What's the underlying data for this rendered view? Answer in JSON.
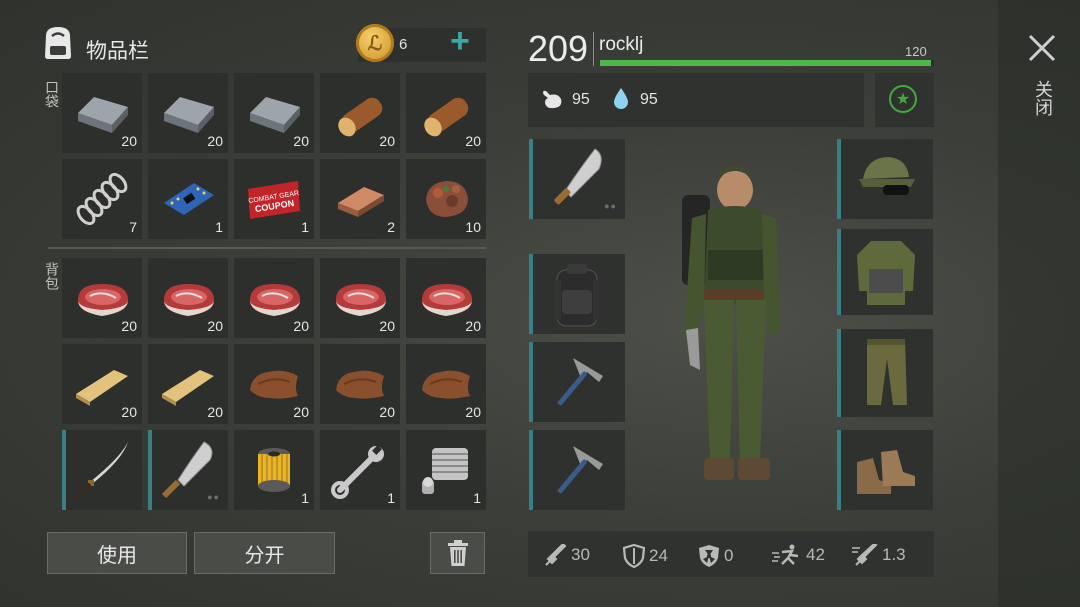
{
  "inventory": {
    "title": "物品栏",
    "coins": "6",
    "add_label": "+",
    "pocket_label": "口袋",
    "backpack_label": "背包",
    "pocket_items": [
      {
        "icon": "iron-bar-icon",
        "count": "20"
      },
      {
        "icon": "iron-bar-icon",
        "count": "20"
      },
      {
        "icon": "iron-bar-icon",
        "count": "20"
      },
      {
        "icon": "log-icon",
        "count": "20"
      },
      {
        "icon": "log-icon",
        "count": "20"
      },
      {
        "icon": "spring-icon",
        "count": "7"
      },
      {
        "icon": "circuit-board-icon",
        "count": "1"
      },
      {
        "icon": "coupon-icon",
        "count": "1",
        "text": "COMBAT GEAR COUPON"
      },
      {
        "icon": "copper-bar-icon",
        "count": "2"
      },
      {
        "icon": "ore-icon",
        "count": "10"
      }
    ],
    "backpack_items": [
      {
        "icon": "raw-meat-icon",
        "count": "20"
      },
      {
        "icon": "raw-meat-icon",
        "count": "20"
      },
      {
        "icon": "raw-meat-icon",
        "count": "20"
      },
      {
        "icon": "raw-meat-icon",
        "count": "20"
      },
      {
        "icon": "raw-meat-icon",
        "count": "20"
      },
      {
        "icon": "wood-plank-icon",
        "count": "20"
      },
      {
        "icon": "wood-plank-icon",
        "count": "20"
      },
      {
        "icon": "leather-icon",
        "count": "20"
      },
      {
        "icon": "leather-icon",
        "count": "20"
      },
      {
        "icon": "leather-icon",
        "count": "20"
      },
      {
        "icon": "katana-icon",
        "count": ""
      },
      {
        "icon": "machete-icon",
        "count": ""
      },
      {
        "icon": "filter-icon",
        "count": "1"
      },
      {
        "icon": "wrench-icon",
        "count": "1"
      },
      {
        "icon": "engine-cylinder-icon",
        "count": "1"
      }
    ],
    "use_button": "使用",
    "split_button": "分开"
  },
  "player": {
    "level": "209",
    "name": "rocklj",
    "xp_value": "120",
    "xp_fraction": 0.99,
    "hunger": "95",
    "thirst": "95"
  },
  "equipment": {
    "left": [
      "machete-icon",
      "backpack-icon",
      "pickaxe-icon",
      "pickaxe-icon"
    ],
    "right": [
      "cap-icon",
      "jacket-icon",
      "pants-icon",
      "boots-icon"
    ]
  },
  "stats": {
    "damage": "30",
    "armor": "24",
    "radiation": "0",
    "speed": "42",
    "attack_speed": "1.3"
  },
  "close_label": "关闭",
  "colors": {
    "accent": "#3aa9a4",
    "xp_bar": "#4fb84a",
    "coin": "#d8a33a"
  }
}
